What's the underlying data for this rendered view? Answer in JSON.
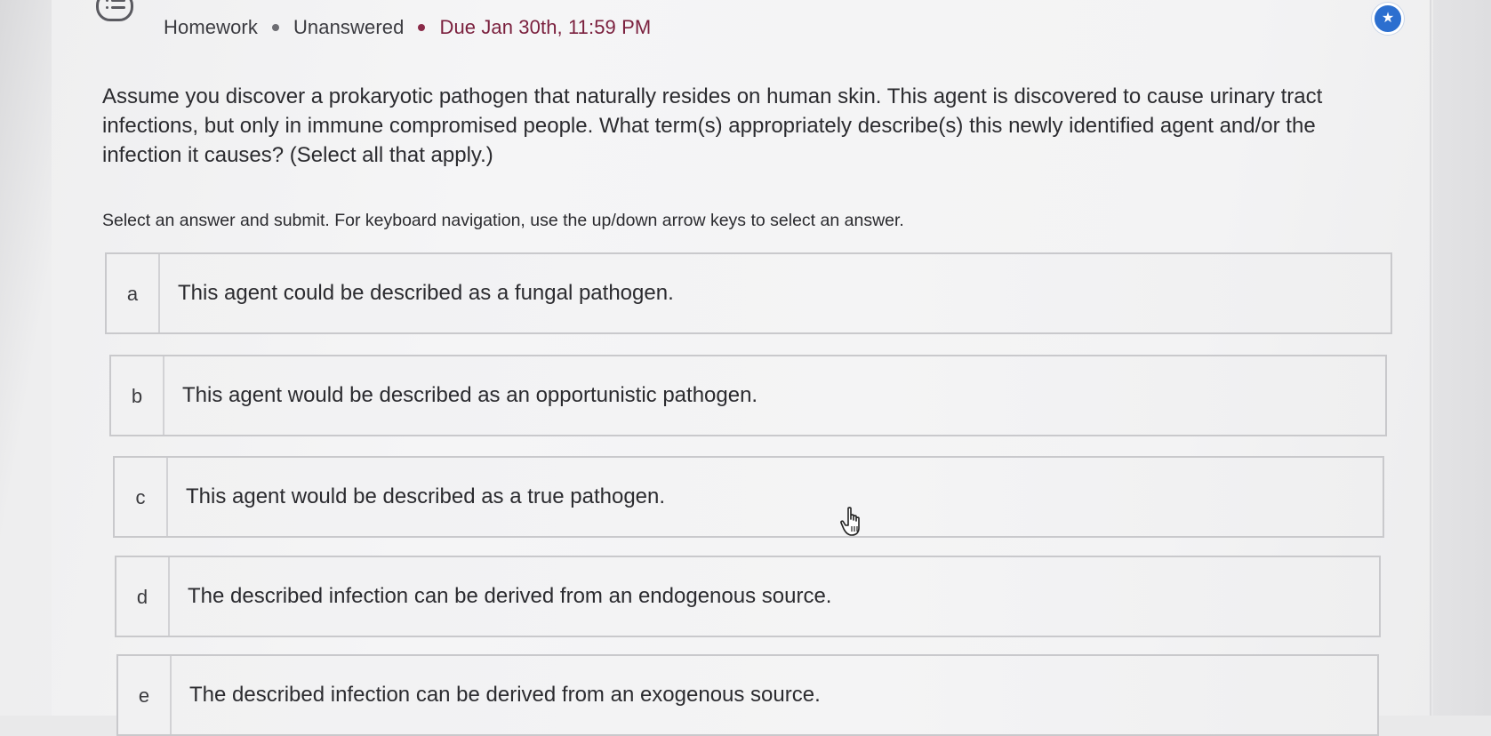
{
  "header": {
    "category": "Homework",
    "status": "Unanswered",
    "due": "Due Jan 30th, 11:59 PM"
  },
  "question": {
    "text": "Assume you discover a prokaryotic pathogen that naturally resides on human skin. This agent is discovered to cause urinary tract infections, but only in immune compromised people. What term(s) appropriately describe(s) this newly identified agent and/or the infection it causes? (Select all that apply.)",
    "instructions": "Select an answer and submit. For keyboard navigation, use the up/down arrow keys to select an answer."
  },
  "options": [
    {
      "letter": "a",
      "text": "This agent could be described as a fungal pathogen."
    },
    {
      "letter": "b",
      "text": "This agent would be described as an opportunistic pathogen."
    },
    {
      "letter": "c",
      "text": "This agent would be described as a true pathogen."
    },
    {
      "letter": "d",
      "text": "The described infection can be derived from an endogenous source."
    },
    {
      "letter": "e",
      "text": "The described infection can be derived from an exogenous source."
    }
  ],
  "colors": {
    "due_text": "#7a1f3d",
    "star_button": "#2c6fcf"
  },
  "icons": {
    "chat": "chat-bubble-list-icon",
    "star": "star-icon",
    "cursor": "hand-pointer-icon"
  }
}
